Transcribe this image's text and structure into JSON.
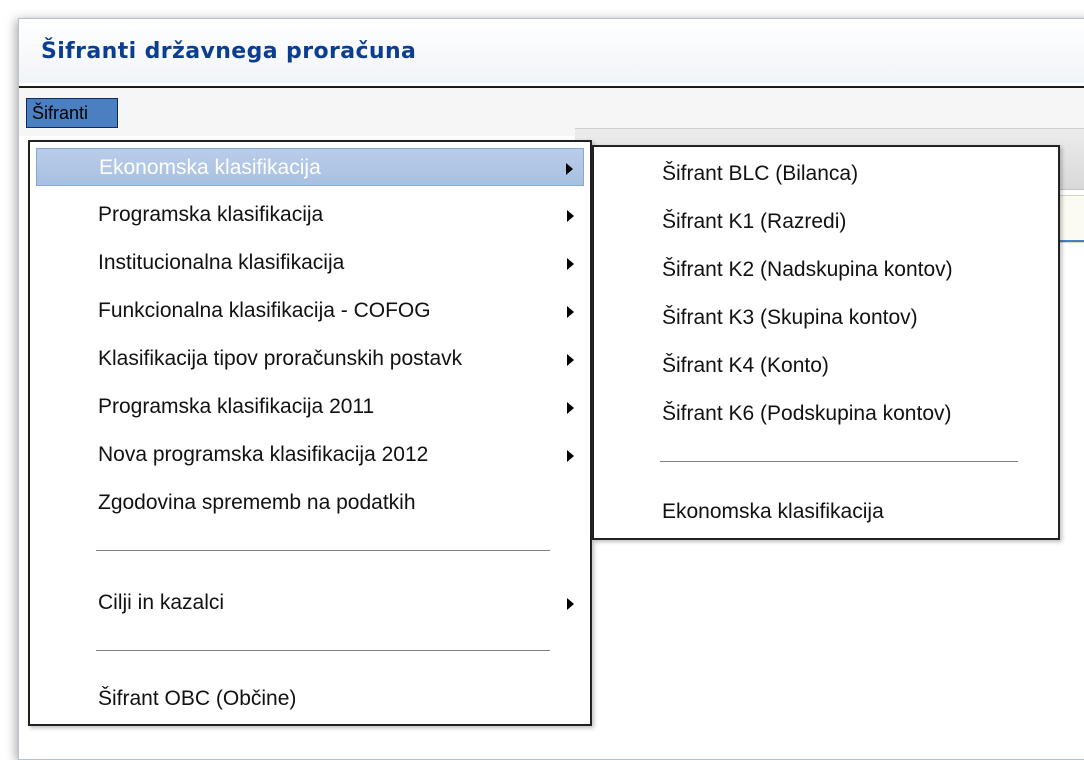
{
  "window": {
    "title": "Šifranti državnega proračuna"
  },
  "menubar": {
    "menu_label": "Šifranti"
  },
  "main_menu": {
    "items": [
      {
        "label": "Ekonomska klasifikacija"
      },
      {
        "label": "Programska klasifikacija"
      },
      {
        "label": "Institucionalna klasifikacija"
      },
      {
        "label": "Funkcionalna klasifikacija - COFOG"
      },
      {
        "label": "Klasifikacija tipov proračunskih postavk"
      },
      {
        "label": "Programska klasifikacija 2011"
      },
      {
        "label": "Nova programska klasifikacija 2012"
      },
      {
        "label": "Zgodovina sprememb na podatkih"
      },
      {
        "label": "Cilji in kazalci"
      },
      {
        "label": "Šifrant OBC (Občine)"
      }
    ]
  },
  "sub_menu": {
    "items": [
      {
        "label": "Šifrant BLC (Bilanca)"
      },
      {
        "label": "Šifrant K1 (Razredi)"
      },
      {
        "label": "Šifrant K2 (Nadskupina kontov)"
      },
      {
        "label": "Šifrant K3 (Skupina kontov)"
      },
      {
        "label": "Šifrant K4 (Konto)"
      },
      {
        "label": "Šifrant K6 (Podskupina kontov)"
      },
      {
        "label": "Ekonomska klasifikacija"
      }
    ]
  },
  "colors": {
    "title": "#0b3d91",
    "highlight": "#b0c6e5",
    "menu_button": "#4a7fc1"
  },
  "icons": {
    "submenu": "chevron-right-icon"
  }
}
